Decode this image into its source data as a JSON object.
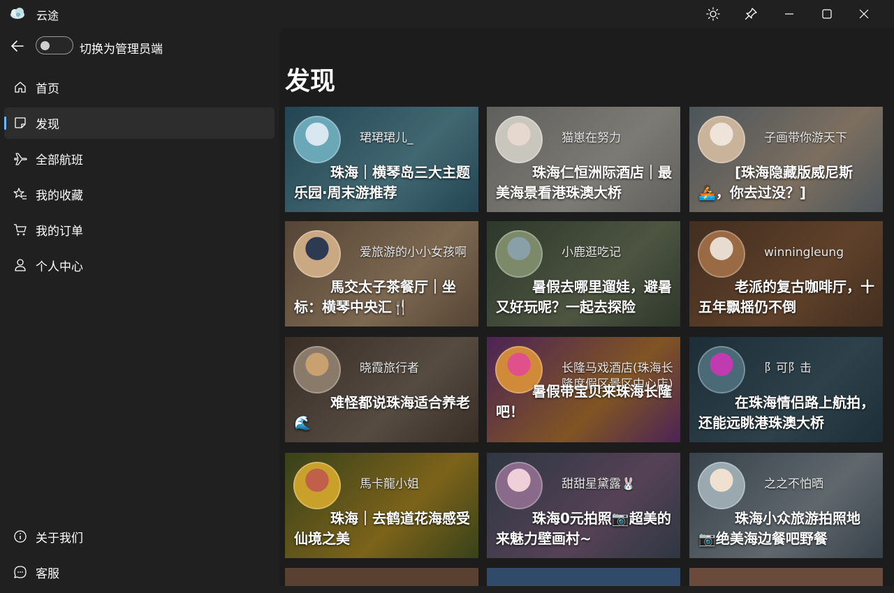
{
  "app": {
    "title": "云途"
  },
  "titlebar": {
    "theme_icon": "sun-icon",
    "pin_icon": "pin-icon",
    "minimize_icon": "minimize-icon",
    "maximize_icon": "maximize-icon",
    "close_icon": "close-icon"
  },
  "toggle": {
    "label": "切换为管理员端",
    "on": false
  },
  "nav": {
    "items": [
      {
        "label": "首页",
        "icon": "home-icon",
        "active": false
      },
      {
        "label": "发现",
        "icon": "note-icon",
        "active": true
      },
      {
        "label": "全部航班",
        "icon": "airplane-icon",
        "active": false
      },
      {
        "label": "我的收藏",
        "icon": "star-list-icon",
        "active": false
      },
      {
        "label": "我的订单",
        "icon": "cart-icon",
        "active": false
      },
      {
        "label": "个人中心",
        "icon": "person-icon",
        "active": false
      }
    ],
    "footer": [
      {
        "label": "关于我们",
        "icon": "info-icon"
      },
      {
        "label": "客服",
        "icon": "chat-icon"
      }
    ]
  },
  "page": {
    "title": "发现"
  },
  "cards": [
    {
      "author": "珺珺珺儿_",
      "title": "珠海｜横琴岛三大主题乐园·周末游推荐",
      "bg": "#3a6f86",
      "bg2": "#6aa8b8",
      "avatar": "#d9e8f0"
    },
    {
      "author": "猫崽在努力",
      "title": "珠海仁恒洲际酒店｜最美海景看港珠澳大桥",
      "bg": "#9a9a94",
      "bg2": "#c8c6bd",
      "avatar": "#e7d8cf"
    },
    {
      "author": "子画带你游天下",
      "title": "[珠海隐藏版威尼斯🚣，你去过没？]",
      "bg": "#7b8a94",
      "bg2": "#c9b39a",
      "avatar": "#efe4da"
    },
    {
      "author": "爱旅游的小小女孩啊",
      "title": "馬交太子茶餐厅｜坐标：横琴中央汇🍴",
      "bg": "#8a6f57",
      "bg2": "#c9a882",
      "avatar": "#2d3a52"
    },
    {
      "author": "小鹿逛吃记",
      "title": "暑假去哪里遛娃，避暑又好玩呢？一起去探险",
      "bg": "#4a5a45",
      "bg2": "#7d8a6a",
      "avatar": "#8aa0a8"
    },
    {
      "author": "winningleung",
      "title": "老派的复古咖啡厅，十五年飘摇仍不倒",
      "bg": "#6b4a33",
      "bg2": "#9a6a45",
      "avatar": "#e8dcd0"
    },
    {
      "author": "晓霞旅行者",
      "title": "难怪都说珠海适合养老🌊",
      "bg": "#5a4a3e",
      "bg2": "#8a7a6a",
      "avatar": "#c9a070"
    },
    {
      "author": "长隆马戏酒店(珠海长隆度假区景区中心店)",
      "title": "暑假带宝贝来珠海长隆吧！",
      "bg": "#7a3a8a",
      "bg2": "#d08a3a",
      "avatar": "#e0508a"
    },
    {
      "author": "阝可阝击",
      "title": "在珠海情侣路上航拍，还能远眺港珠澳大桥",
      "bg": "#2f4a5a",
      "bg2": "#4a6a78",
      "avatar": "#c03ab0"
    },
    {
      "author": "馬卡龍小姐",
      "title": "珠海｜去鹤道花海感受仙境之美",
      "bg": "#5a6a2a",
      "bg2": "#c9a02a",
      "avatar": "#c0604a"
    },
    {
      "author": "甜甜星黛露🐰",
      "title": "珠海0元拍照📷超美的来魅力壁画村~",
      "bg": "#4a5a6a",
      "bg2": "#8a6a8a",
      "avatar": "#f0d0d8"
    },
    {
      "author": "之之不怕晒",
      "title": "珠海小众旅游拍照地📷绝美海边餐吧野餐",
      "bg": "#5a6a78",
      "bg2": "#9aa8b0",
      "avatar": "#f0e0d0"
    }
  ],
  "partial_cards": [
    {
      "bg": "#5a4030"
    },
    {
      "bg": "#304a6a"
    },
    {
      "bg": "#6a4a3a"
    }
  ]
}
